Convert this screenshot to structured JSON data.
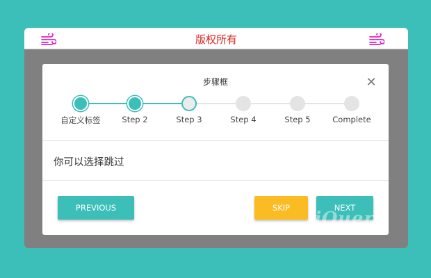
{
  "header": {
    "title": "版权所有",
    "left_icon": "wind-icon",
    "right_icon": "wind-icon",
    "icon_color": "#e020c8"
  },
  "modal": {
    "title": "步骤框",
    "close_symbol": "✕",
    "message": "你可以选择跳过",
    "steps": [
      {
        "label": "自定义标签",
        "state": "done"
      },
      {
        "label": "Step 2",
        "state": "done"
      },
      {
        "label": "Step 3",
        "state": "active"
      },
      {
        "label": "Step 4",
        "state": "todo"
      },
      {
        "label": "Step 5",
        "state": "todo"
      },
      {
        "label": "Complete",
        "state": "todo"
      }
    ],
    "buttons": {
      "previous": "PREVIOUS",
      "skip": "SKIP",
      "next": "NEXT"
    }
  },
  "watermark": "jQuery",
  "colors": {
    "accent": "#3bbfb8",
    "skip": "#fbbb22",
    "title_red": "#e0201f"
  }
}
